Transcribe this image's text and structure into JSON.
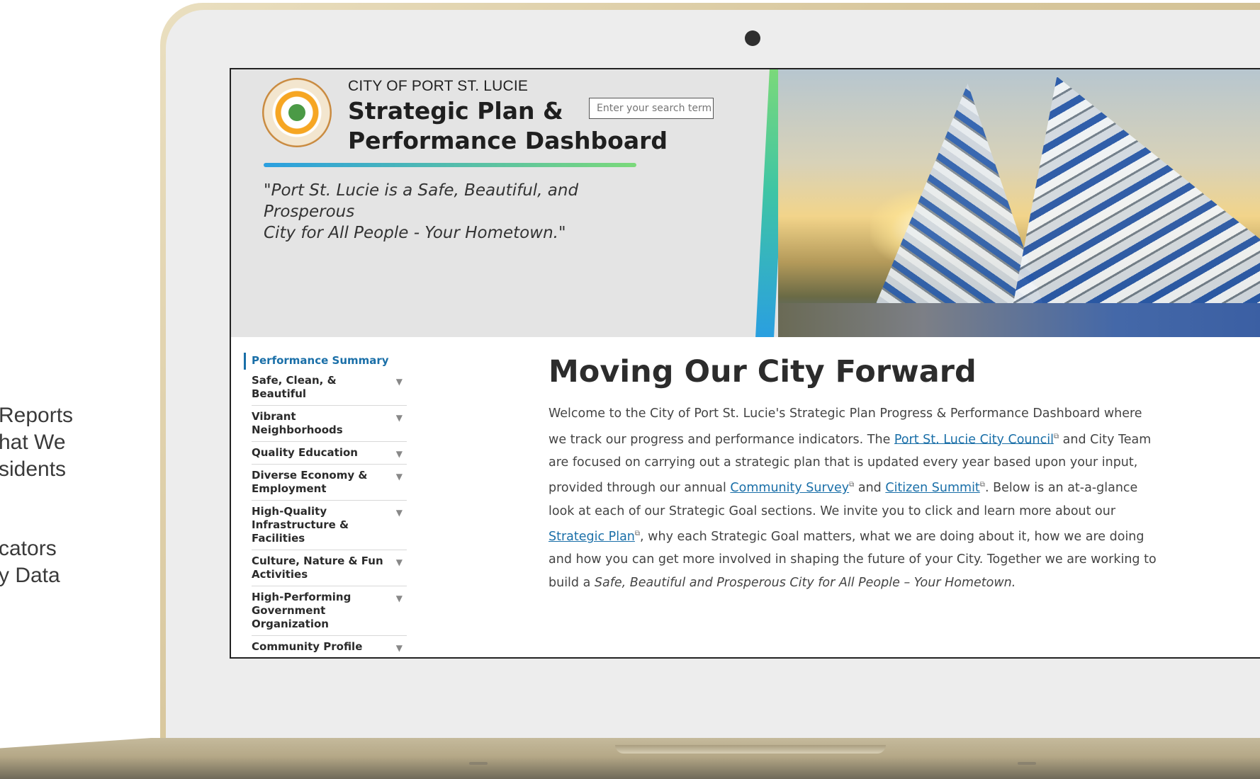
{
  "slide": {
    "text_a": [
      "Reports",
      "hat We",
      "sidents"
    ],
    "text_b": [
      "cators",
      "y Data"
    ]
  },
  "header": {
    "org_name": "CITY OF PORT ST. LUCIE",
    "title_line1": "Strategic Plan &",
    "title_line2": "Performance Dashboard",
    "search_placeholder": "Enter your search term",
    "tagline_line1": "\"Port St. Lucie is a Safe, Beautiful, and Prosperous",
    "tagline_line2": "City for All People  - Your Hometown.\"",
    "seal_text": "CITY of PORT ST LUCIE FLORIDA"
  },
  "sidebar": {
    "active": "Performance Summary",
    "items": [
      {
        "label": "Safe, Clean, & Beautiful"
      },
      {
        "label": "Vibrant Neighborhoods"
      },
      {
        "label": "Quality Education"
      },
      {
        "label": "Diverse Economy & Employment"
      },
      {
        "label": "High-Quality Infrastructure & Facilities"
      },
      {
        "label": "Culture, Nature & Fun Activities"
      },
      {
        "label": "High-Performing Government Organization"
      },
      {
        "label": "Community Profile"
      }
    ]
  },
  "main": {
    "title": "Moving Our City Forward",
    "p1": "Welcome to the City of Port St. Lucie's Strategic Plan Progress & Performance Dashboard where we track our progress and performance indicators. The ",
    "link_council": "Port St. Lucie City Council",
    "p2": " and City Team are focused on carrying out a strategic plan that is updated every year based upon your input, provided through our annual ",
    "link_survey": "Community Survey",
    "p3": " and ",
    "link_summit": "Citizen Summit",
    "p4": ". Below is an at-a-glance look at each of our Strategic Goal sections. We invite you to click and learn more about our ",
    "link_plan": "Strategic Plan",
    "p5": ", why each Strategic Goal matters, what we are doing about it, how we are doing and how you can get more involved in shaping the future of your City. Together we are working to build a ",
    "p6_italic": "Safe, Beautiful and Prosperous City for All People – Your Hometown.",
    "ext_mark": "⧉"
  }
}
